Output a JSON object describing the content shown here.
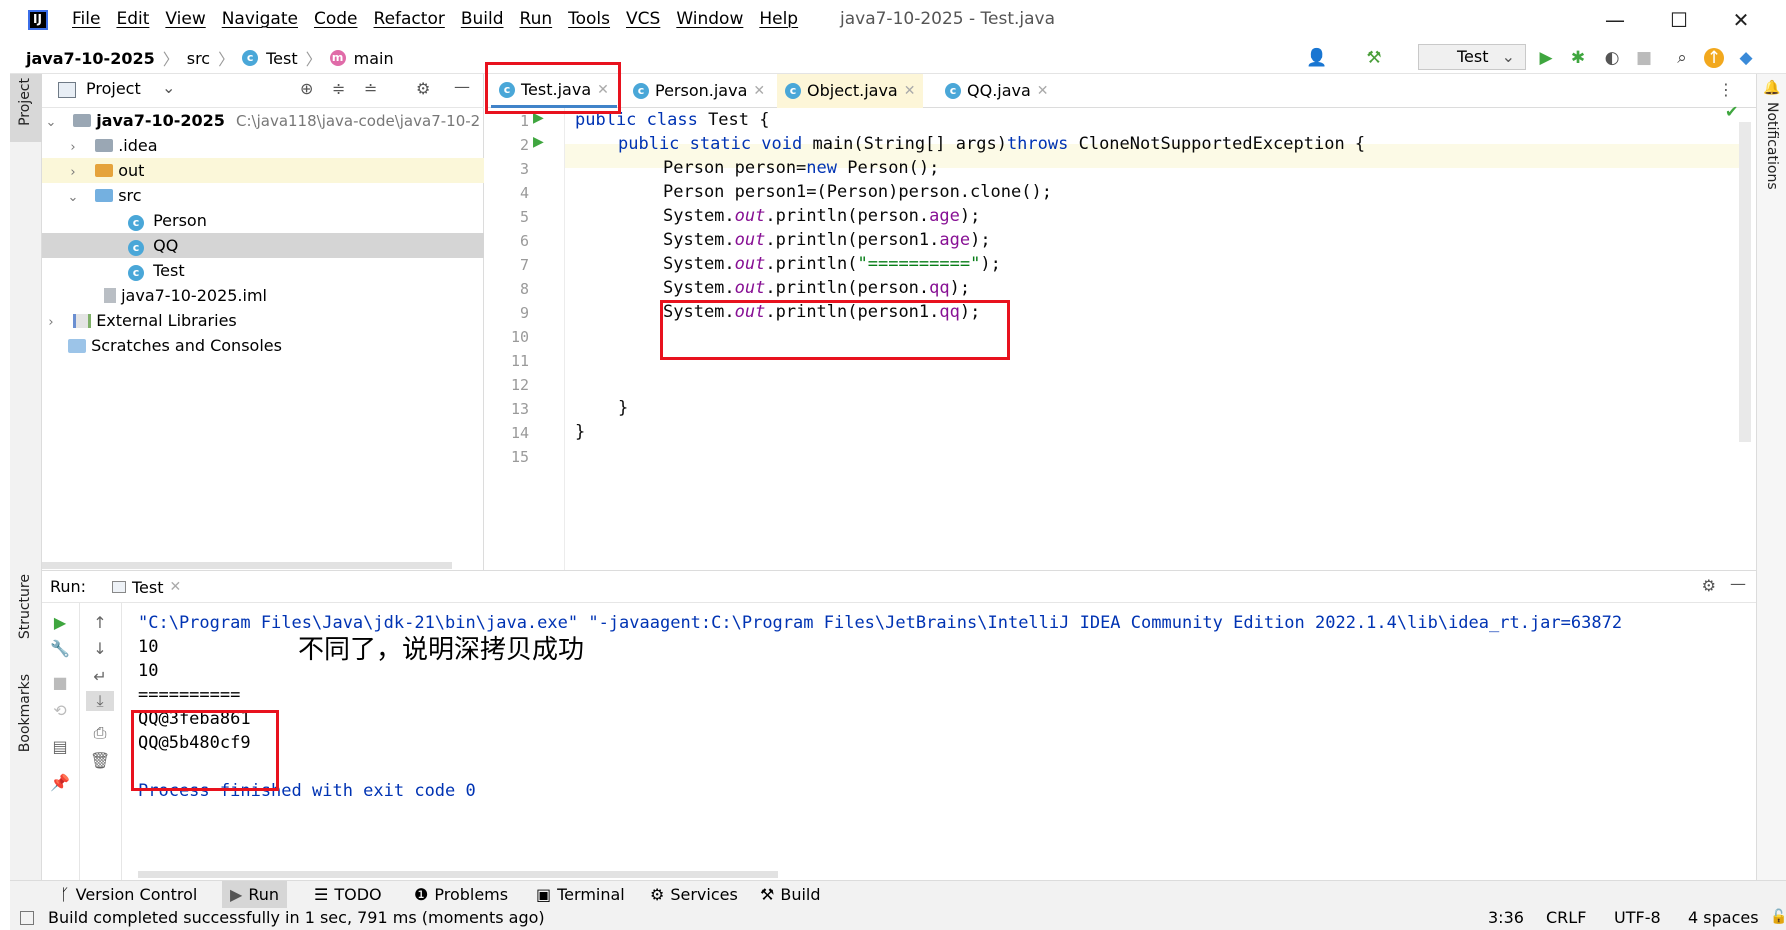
{
  "menubar": {
    "items": [
      "File",
      "Edit",
      "View",
      "Navigate",
      "Code",
      "Refactor",
      "Build",
      "Run",
      "Tools",
      "VCS",
      "Window",
      "Help"
    ],
    "window_title": "java7-10-2025 - Test.java"
  },
  "navbar": {
    "project": "java7-10-2025",
    "src": "src",
    "class": "Test",
    "method": "main",
    "run_config": "Test"
  },
  "left_strip": {
    "project": "Project",
    "structure": "Structure",
    "bookmarks": "Bookmarks"
  },
  "project_panel": {
    "title": "Project",
    "tree": [
      {
        "label": "java7-10-2025",
        "extra": "C:\\java118\\java-code\\java7-10-2"
      },
      {
        "label": ".idea"
      },
      {
        "label": "out"
      },
      {
        "label": "src"
      },
      {
        "label": "Person"
      },
      {
        "label": "QQ"
      },
      {
        "label": "Test"
      },
      {
        "label": "java7-10-2025.iml"
      },
      {
        "label": "External Libraries"
      },
      {
        "label": "Scratches and Consoles"
      }
    ]
  },
  "tabs": [
    {
      "label": "Test.java"
    },
    {
      "label": "Person.java"
    },
    {
      "label": "Object.java"
    },
    {
      "label": "QQ.java"
    }
  ],
  "editor": {
    "line_numbers": [
      "1",
      "2",
      "3",
      "4",
      "5",
      "6",
      "7",
      "8",
      "9",
      "10",
      "11",
      "12",
      "13",
      "14",
      "15"
    ],
    "lines": {
      "l1_kw": "public class",
      "l1_rest": " Test {",
      "l2_kw": "public static void",
      "l2_rest": " main(String[] args)",
      "l2_kw2": "throws",
      "l2_rest2": " CloneNotSupportedException {",
      "l3_a": "Person person=",
      "l3_kw": "new",
      "l3_b": " Person();",
      "l4": "Person person1=(Person)person.clone();",
      "sys": "System.",
      "out": "out",
      "println": ".println(",
      "l5_var": "person.",
      "l5_prop": "age",
      "l6_var": "person1.",
      "l6_prop": "age",
      "l7_str": "\"==========\"",
      "l8_var": "person.",
      "l8_prop": "qq",
      "l9_var": "person1.",
      "l9_prop": "qq",
      "end": ");",
      "close_method": "}",
      "close_class": "}"
    }
  },
  "run_panel": {
    "label": "Run:",
    "tab": "Test",
    "output": [
      "\"C:\\Program Files\\Java\\jdk-21\\bin\\java.exe\" \"-javaagent:C:\\Program Files\\JetBrains\\IntelliJ IDEA Community Edition 2022.1.4\\lib\\idea_rt.jar=63872",
      "10",
      "10",
      "==========",
      "QQ@3feba861",
      "QQ@5b480cf9",
      "",
      "Process finished with exit code 0"
    ],
    "annotation": "不同了，说明深拷贝成功"
  },
  "bottom_tabs": [
    "Version Control",
    "Run",
    "TODO",
    "Problems",
    "Terminal",
    "Services",
    "Build"
  ],
  "status": {
    "message": "Build completed successfully in 1 sec, 791 ms (moments ago)",
    "position": "3:36",
    "line_sep": "CRLF",
    "encoding": "UTF-8",
    "indent": "4 spaces"
  },
  "right_strip": {
    "notifications": "Notifications"
  }
}
